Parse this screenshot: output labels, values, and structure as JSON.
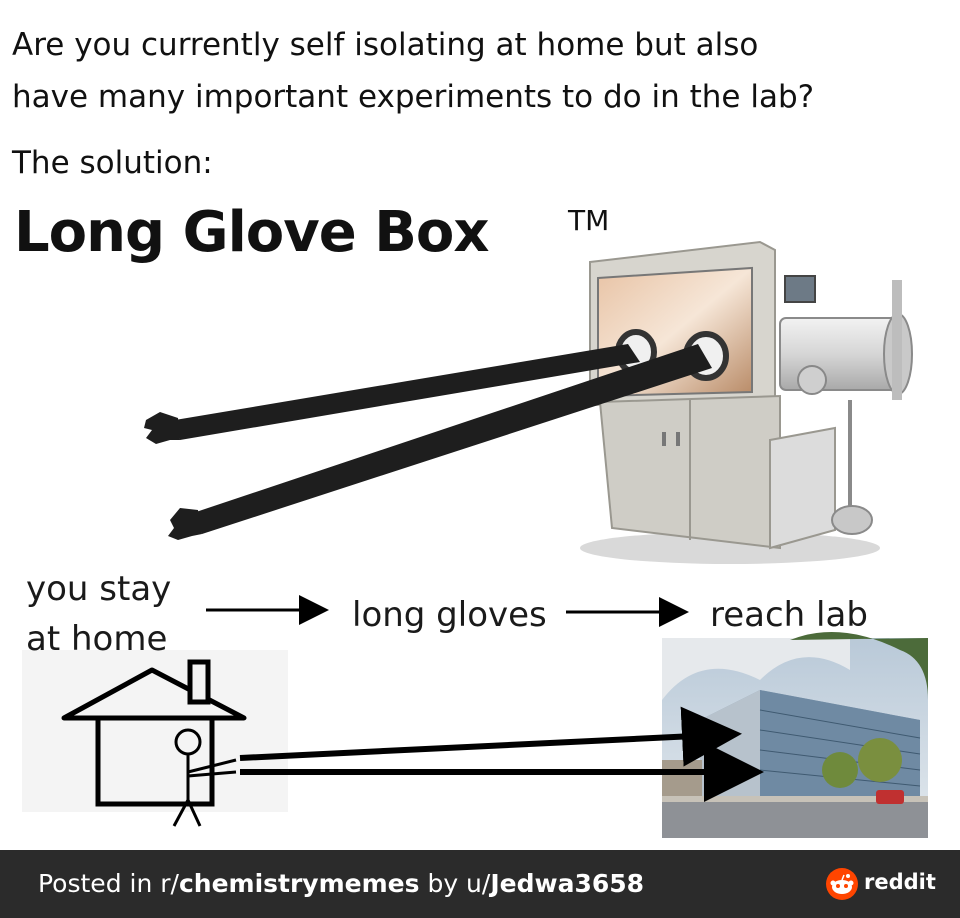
{
  "header": {
    "question_line1": "Are you currently self isolating at home but also",
    "question_line2": "have many important experiments to do in the lab?",
    "solution_label": "The solution:",
    "product_name": "Long Glove Box",
    "trademark": "TM"
  },
  "diagram": {
    "step1_line1": "you stay",
    "step1_line2": "at home",
    "step2": "long gloves",
    "step3": "reach lab"
  },
  "footer": {
    "posted_in": "Posted in r/",
    "subreddit": "chemistrymemes",
    "by": " by u/",
    "username": "Jedwa3658",
    "brand": "reddit"
  },
  "colors": {
    "footer_bg": "#2b2b2b",
    "reddit_orange": "#ff4500"
  },
  "icons": [
    "glove-box-illustration",
    "house-doodle-icon",
    "lab-building-photo",
    "reddit-logo-icon"
  ]
}
